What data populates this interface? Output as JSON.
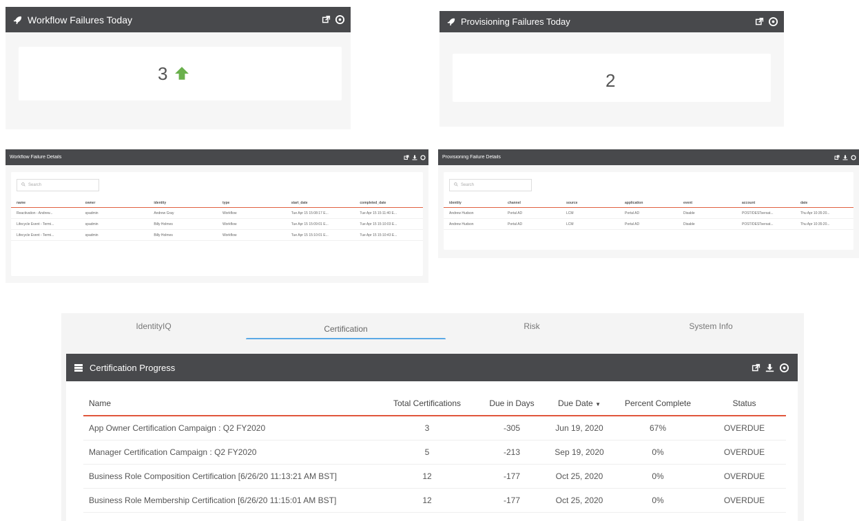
{
  "workflow_failures_today": {
    "title": "Workflow Failures Today",
    "count": "3",
    "trend": "up",
    "trend_color": "#6ab04c"
  },
  "provisioning_failures_today": {
    "title": "Provisioning Failures Today",
    "count": "2"
  },
  "workflow_failure_details": {
    "title": "Workflow Failure Details",
    "search_placeholder": "Search",
    "columns": [
      "name",
      "owner",
      "identity",
      "type",
      "start_date",
      "completed_date"
    ],
    "rows": [
      [
        "Reactivation - Andrew...",
        "spadmin",
        "Andrew Gray",
        "Workflow",
        "Tue Apr 15 15:08:17 E...",
        "Tue Apr 15 15:11:40 E..."
      ],
      [
        "Lifecycle Event - Termi...",
        "spadmin",
        "Billy Holmes",
        "Workflow",
        "Tue Apr 15 15:09:01 E...",
        "Tue Apr 15 15:10:03 E..."
      ],
      [
        "Lifecycle Event - Termi...",
        "spadmin",
        "Billy Holmes",
        "Workflow",
        "Tue Apr 15 15:10:01 E...",
        "Tue Apr 15 15:10:43 E..."
      ]
    ]
  },
  "provisioning_failure_details": {
    "title": "Provisioning Failure Details",
    "search_placeholder": "Search",
    "columns": [
      "identity",
      "channel",
      "source",
      "application",
      "event",
      "account",
      "date"
    ],
    "rows": [
      [
        "Andrew Hudson",
        "Portal AD",
        "LCM",
        "Portal AD",
        "Disable",
        "POST/DESTsersat...",
        "Thu Apr 10:35:20..."
      ],
      [
        "Andrew Hudson",
        "Portal AD",
        "LCM",
        "Portal AD",
        "Disable",
        "POST/DESTsersat...",
        "Thu Apr 10:35:20..."
      ]
    ]
  },
  "tabs": {
    "items": [
      "IdentityIQ",
      "Certification",
      "Risk",
      "System Info"
    ],
    "active": "Certification"
  },
  "certification_progress": {
    "title": "Certification Progress",
    "columns": [
      "Name",
      "Total Certifications",
      "Due in Days",
      "Due Date",
      "Percent Complete",
      "Status"
    ],
    "sorted_column": "Due Date",
    "rows": [
      [
        "App Owner Certification Campaign : Q2 FY2020",
        "3",
        "-305",
        "Jun 19, 2020",
        "67%",
        "OVERDUE"
      ],
      [
        "Manager Certification Campaign : Q2 FY2020",
        "5",
        "-213",
        "Sep 19, 2020",
        "0%",
        "OVERDUE"
      ],
      [
        "Business Role Composition Certification [6/26/20 11:13:21 AM BST]",
        "12",
        "-177",
        "Oct 25, 2020",
        "0%",
        "OVERDUE"
      ],
      [
        "Business Role Membership Certification [6/26/20 11:15:01 AM BST]",
        "12",
        "-177",
        "Oct 25, 2020",
        "0%",
        "OVERDUE"
      ]
    ]
  },
  "colors": {
    "header_bg": "#48494c",
    "accent_red": "#e0553a",
    "tab_active_bar": "#5aa9e6"
  }
}
